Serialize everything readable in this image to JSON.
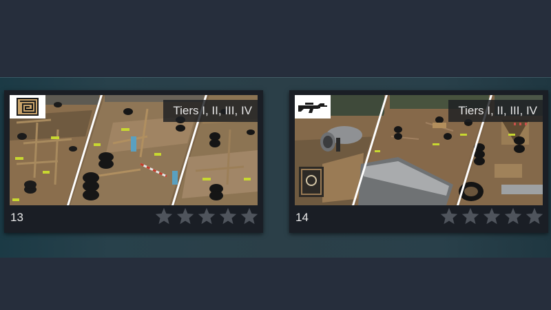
{
  "cards": [
    {
      "level": "13",
      "tiers": "Tiers I, II, III, IV",
      "icon": "maze-icon",
      "stars_earned": 0,
      "stars_total": 5
    },
    {
      "level": "14",
      "tiers": "Tiers I, II, III, IV",
      "icon": "rifle-icon",
      "stars_earned": 0,
      "stars_total": 5
    }
  ],
  "colors": {
    "background": "#262e3c",
    "band": "#2b3f48",
    "card": "#1a1e25",
    "star_empty": "#4f545c",
    "text": "#e8e8e8"
  }
}
